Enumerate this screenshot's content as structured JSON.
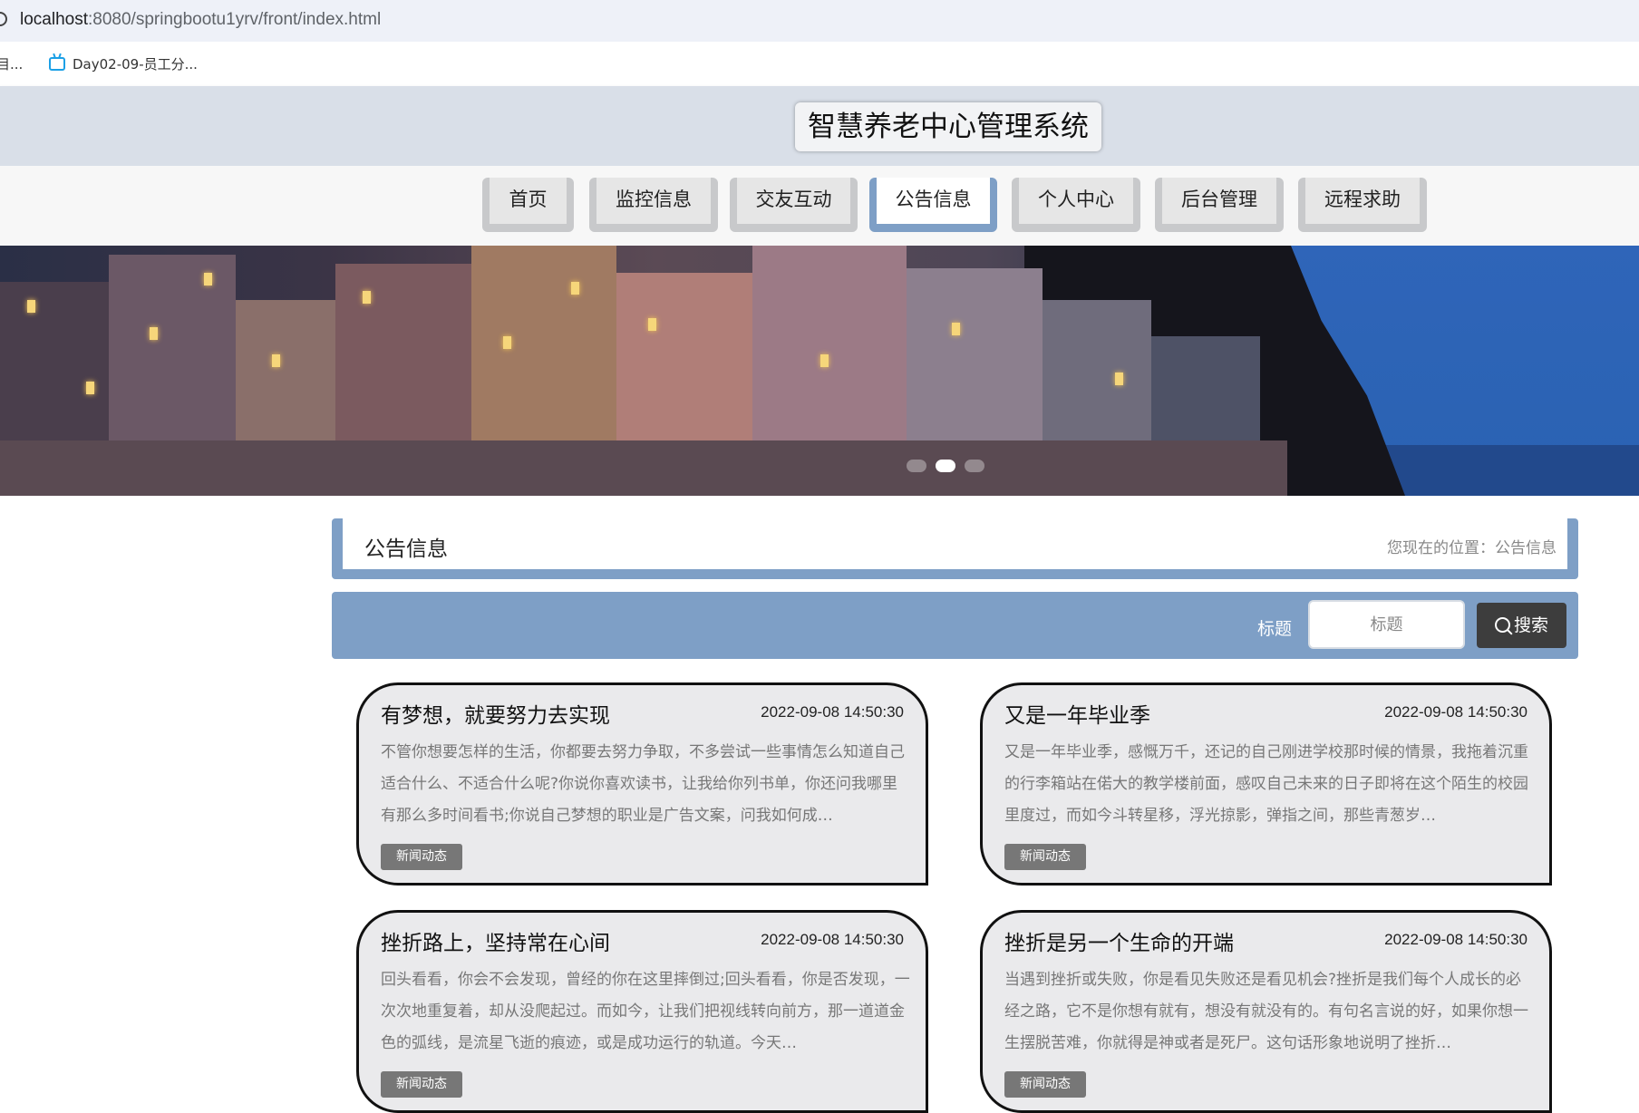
{
  "browser": {
    "url_host": "localhost",
    "url_path": ":8080/springbootu1yrv/front/index.html",
    "bookmarks": [
      {
        "label": "目..."
      },
      {
        "label": "Day02-09-员工分..."
      }
    ]
  },
  "header": {
    "title": "智慧养老中心管理系统"
  },
  "nav": {
    "items": [
      {
        "label": "首页",
        "active": false
      },
      {
        "label": "监控信息",
        "active": false
      },
      {
        "label": "交友互动",
        "active": false
      },
      {
        "label": "公告信息",
        "active": true
      },
      {
        "label": "个人中心",
        "active": false
      },
      {
        "label": "后台管理",
        "active": false
      },
      {
        "label": "远程求助",
        "active": false
      }
    ]
  },
  "banner": {
    "slides_total": 3,
    "active_slide": 2
  },
  "breadcrumb": {
    "title": "公告信息",
    "location": "您现在的位置：公告信息"
  },
  "search": {
    "label": "标题",
    "placeholder": "标题",
    "value": "",
    "button_label": "搜索"
  },
  "cards": [
    {
      "title": "有梦想，就要努力去实现",
      "date": "2022-09-08 14:50:30",
      "body": "不管你想要怎样的生活，你都要去努力争取，不多尝试一些事情怎么知道自己适合什么、不适合什么呢?你说你喜欢读书，让我给你列书单，你还问我哪里有那么多时间看书;你说自己梦想的职业是广告文案，问我如何成…",
      "tag": "新闻动态"
    },
    {
      "title": "又是一年毕业季",
      "date": "2022-09-08 14:50:30",
      "body": "又是一年毕业季，感慨万千，还记的自己刚进学校那时候的情景，我拖着沉重的行李箱站在偌大的教学楼前面，感叹自己未来的日子即将在这个陌生的校园里度过，而如今斗转星移，浮光掠影，弹指之间，那些青葱岁…",
      "tag": "新闻动态"
    },
    {
      "title": "挫折路上，坚持常在心间",
      "date": "2022-09-08 14:50:30",
      "body": "回头看看，你会不会发现，曾经的你在这里摔倒过;回头看看，你是否发现，一次次地重复着，却从没爬起过。而如今，让我们把视线转向前方，那一道道金色的弧线，是流星飞逝的痕迹，或是成功运行的轨道。今天…",
      "tag": "新闻动态"
    },
    {
      "title": "挫折是另一个生命的开端",
      "date": "2022-09-08 14:50:30",
      "body": "当遇到挫折或失败，你是看见失败还是看见机会?挫折是我们每个人成长的必经之路，它不是你想有就有，想没有就没有的。有句名言说的好，如果你想一生摆脱苦难，你就得是神或者是死尸。这句话形象地说明了挫折…",
      "tag": "新闻动态"
    }
  ],
  "colors": {
    "accent": "#7e9fc6",
    "header_bg": "#d9dfe8",
    "card_bg": "#eaeaec",
    "tag_bg": "#777777",
    "search_button_bg": "#3d3d3d"
  }
}
